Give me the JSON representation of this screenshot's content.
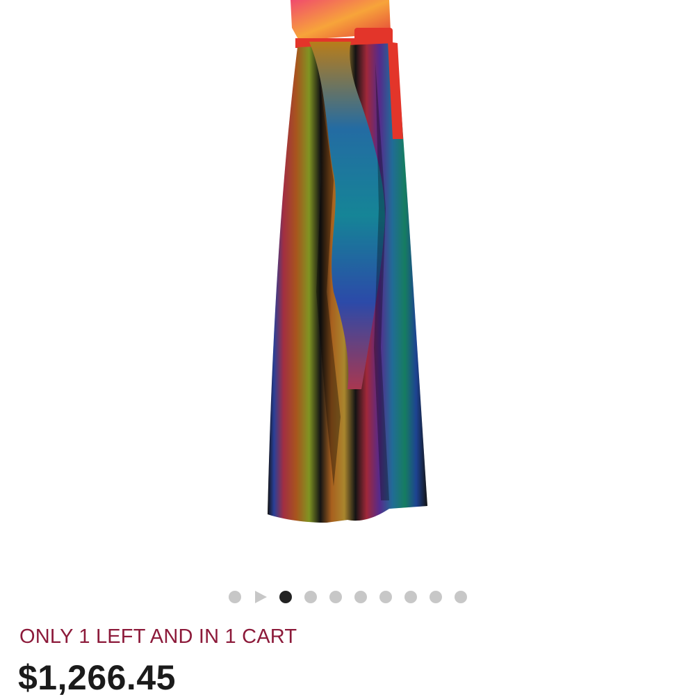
{
  "product": {
    "image_alt": "",
    "stock_message": "ONLY 1 LEFT AND IN 1 CART",
    "price": "$1,266.45"
  },
  "carousel": {
    "total_dots": 9,
    "active_index": 1,
    "has_play_control": true
  },
  "colors": {
    "stock_text": "#8c1a3a",
    "price_text": "#1b1b1b",
    "dot_inactive": "#c7c7c7",
    "dot_active": "#222222"
  },
  "icons": {
    "play": "play-icon"
  }
}
